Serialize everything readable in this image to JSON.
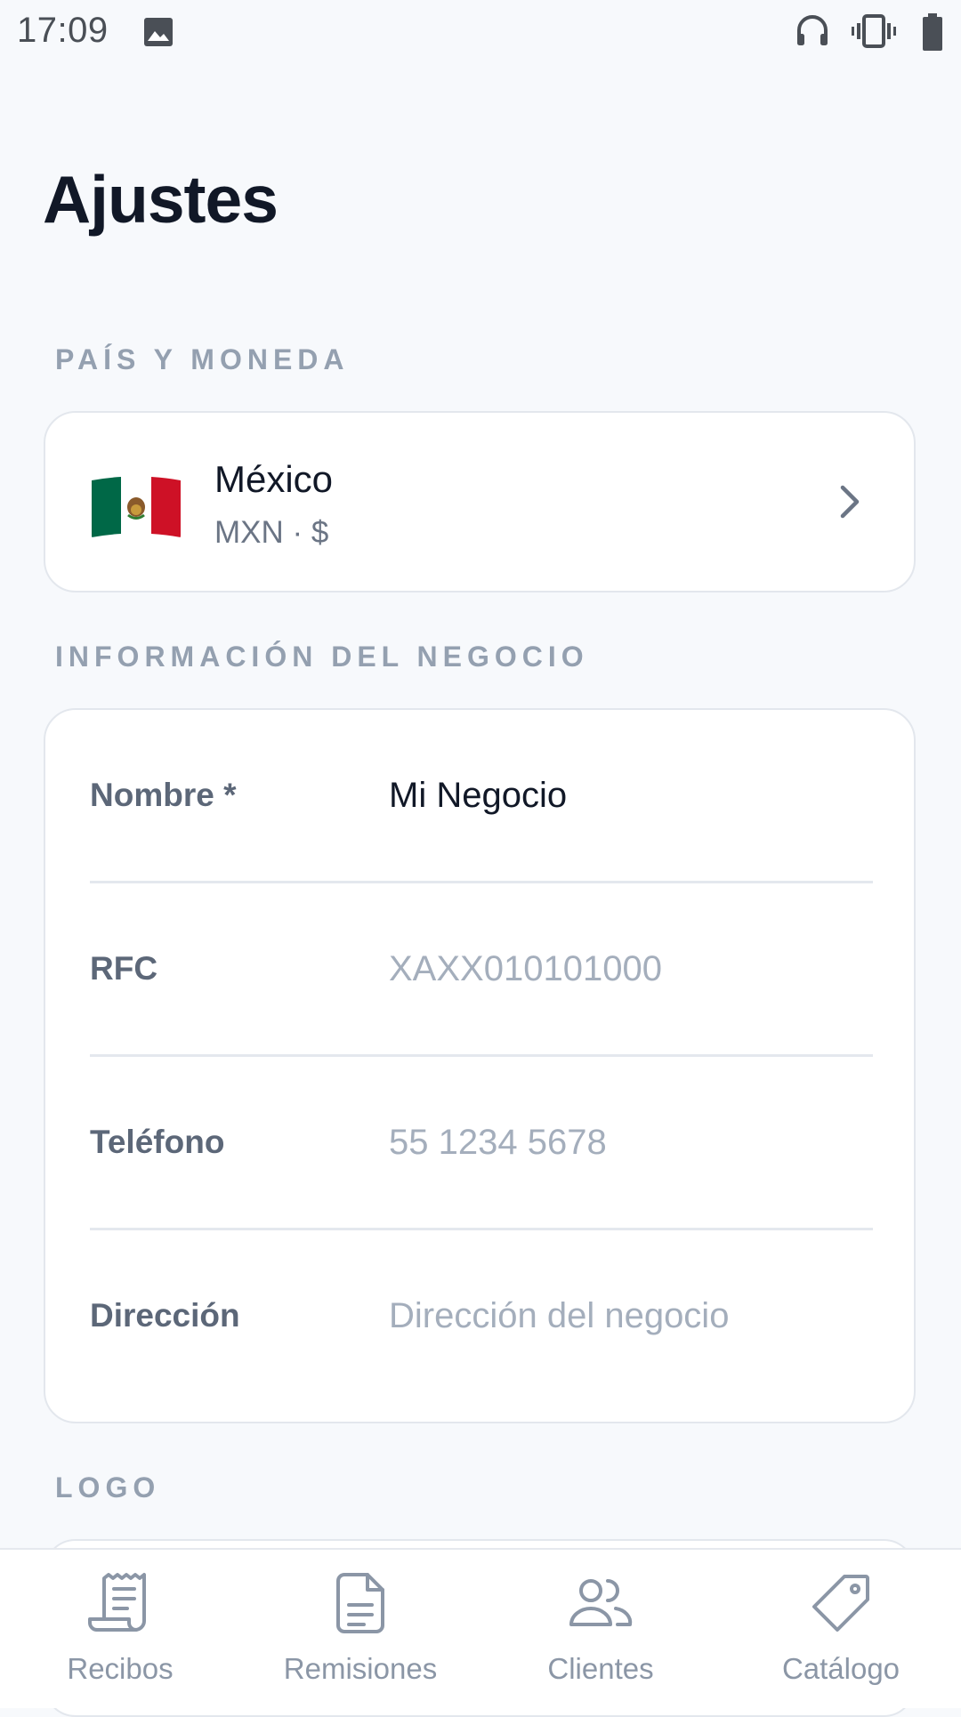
{
  "status_bar": {
    "time": "17:09",
    "icons": [
      "image-icon",
      "headphones-icon",
      "vibrate-icon",
      "battery-icon"
    ]
  },
  "page": {
    "title": "Ajustes"
  },
  "country_section": {
    "label": "PAÍS Y MONEDA",
    "country_name": "México",
    "currency": "MXN · $",
    "flag_icon": "mexico-flag-icon"
  },
  "business_section": {
    "label": "INFORMACIÓN DEL NEGOCIO",
    "fields": [
      {
        "label": "Nombre *",
        "value": "Mi Negocio",
        "placeholder": ""
      },
      {
        "label": "RFC",
        "value": "",
        "placeholder": "XAXX010101000"
      },
      {
        "label": "Teléfono",
        "value": "",
        "placeholder": "55 1234 5678"
      },
      {
        "label": "Dirección",
        "value": "",
        "placeholder": "Dirección del negocio"
      }
    ]
  },
  "logo_section": {
    "label": "LOGO"
  },
  "bottom_nav": {
    "items": [
      {
        "label": "Recibos",
        "icon": "receipt-icon"
      },
      {
        "label": "Remisiones",
        "icon": "document-icon"
      },
      {
        "label": "Clientes",
        "icon": "users-icon"
      },
      {
        "label": "Catálogo",
        "icon": "tag-icon"
      }
    ]
  },
  "colors": {
    "background": "#f7f9fc",
    "card": "#ffffff",
    "title": "#111827",
    "section_label": "#94a0b0",
    "field_label": "#5c6778",
    "placeholder": "#a4aebc",
    "nav_inactive": "#8b96a6",
    "flag_green": "#006847",
    "flag_red": "#ce1126"
  }
}
